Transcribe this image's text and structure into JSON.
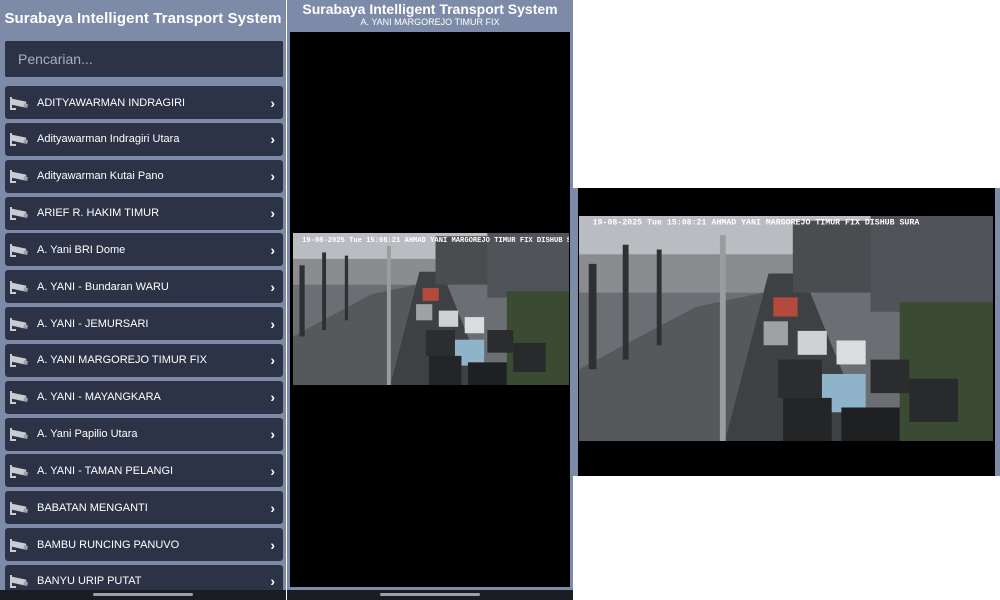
{
  "list_screen": {
    "title": "Surabaya Intelligent Transport System",
    "search_placeholder": "Pencarian...",
    "items": [
      {
        "label": "ADITYAWARMAN INDRAGIRI"
      },
      {
        "label": "Adityawarman Indragiri Utara"
      },
      {
        "label": "Adityawarman Kutai Pano"
      },
      {
        "label": "ARIEF R. HAKIM TIMUR"
      },
      {
        "label": "A. Yani BRI Dome"
      },
      {
        "label": "A. YANI - Bundaran WARU"
      },
      {
        "label": "A. YANI - JEMURSARI"
      },
      {
        "label": "A. YANI MARGOREJO TIMUR FIX"
      },
      {
        "label": "A. YANI - MAYANGKARA"
      },
      {
        "label": "A. Yani Papilio Utara"
      },
      {
        "label": "A. YANI - TAMAN PELANGI"
      },
      {
        "label": "BABATAN MENGANTI"
      },
      {
        "label": "BAMBU RUNCING PANUVO"
      },
      {
        "label": "BANYU URIP PUTAT"
      }
    ],
    "item_icon": "cctv-camera-icon",
    "chevron_icon": "chevron-right-icon"
  },
  "viewer_screen": {
    "title": "Surabaya Intelligent Transport System",
    "camera_name": "A. YANI MARGOREJO TIMUR FIX"
  },
  "landscape_view": {
    "osd_text": "19-08-2025  Tue 15:08:21  AHMAD YANI MARGOREJO TIMUR FIX DISHUB SURA"
  },
  "colors": {
    "panel_bg": "#7d8ba8",
    "item_bg": "#2c3347",
    "video_bg": "#000000"
  }
}
